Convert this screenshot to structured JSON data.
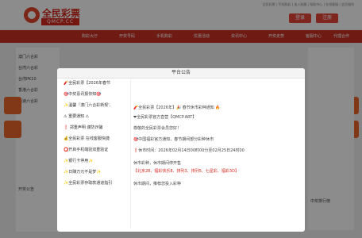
{
  "site": {
    "logo_text": "全民彩票",
    "logo_sub": "QMCP.CC",
    "top_links": "全民彩票 | 手机购彩 | 加入收藏 | 帮助中心 | 在线客服 | 会员福利",
    "login_label": "登录",
    "register_label": "注册"
  },
  "nav": {
    "items": [
      "购彩大厅",
      "开奖号码",
      "手机购彩",
      "优惠活动",
      "资讯中心",
      "开奖走势",
      "客服中心",
      "代理合作"
    ]
  },
  "background": {
    "left_rows": [
      "澳门六合彩",
      "台湾六合彩",
      "台湾PK10",
      "香港六合彩",
      "极速六合彩"
    ],
    "bottom_panel_title": "开奖公告",
    "right_title": "中奖排行榜"
  },
  "modal": {
    "title": "平台公告",
    "list_items": [
      "🧨全民彩票【2026年春节",
      "🎯中奖喜讯报你知🎯",
      "✨温馨『澳门六合彩新规',",
      "⚠ 重要通知 ⚠",
      "❗ 郑重声明 谨防诈骗",
      "💰全民彩票 在线客服快捷",
      "⭕开启手机端验双重验证",
      "✨银行卡停用✨",
      "✨日赚万元不是梦✨",
      "✨全民彩票存取款通道指引"
    ],
    "content": {
      "line1": "🧨全民彩票【2026年】🎉 春节休市彩种通知 🔥",
      "line2": "❤全民彩票官方直营【QMCP.ART】",
      "line3": "尊敬的全民彩票会员您好！",
      "line4": "🎯中国福彩官方通知，春节期间部分彩种休市",
      "line5": "❗休市时间：2026年02月14日00时00分至02月25日24时00",
      "line6": "休市彩种，休市期间停开售",
      "line7": "【北京28、福彩快乐8、排列3、排列5、七星彩、福彩3D】",
      "line8": "休市期间，推荐您投入彩种"
    }
  },
  "colors": {
    "brand_red": "#d62a1e",
    "nav_red": "#cc3126",
    "accent_orange": "#e9672a"
  }
}
